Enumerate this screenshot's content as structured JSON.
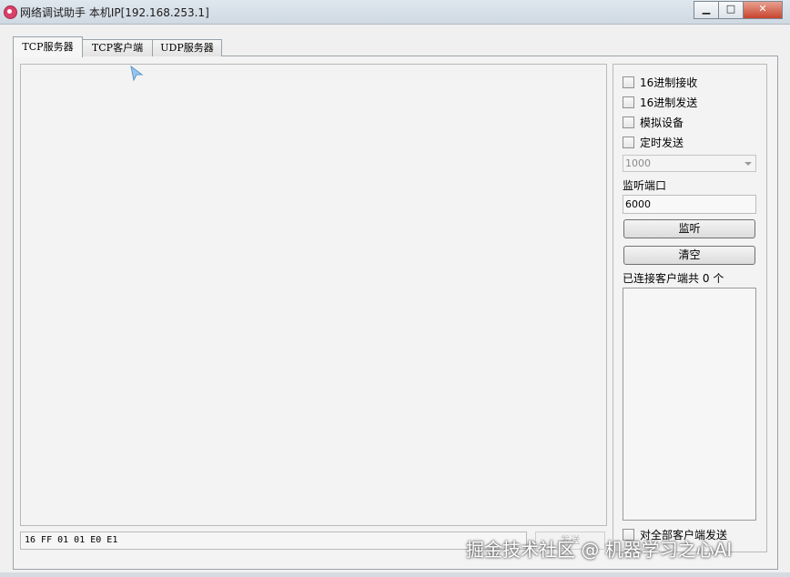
{
  "window": {
    "title": "网络调试助手 本机IP[192.168.253.1]",
    "minimize": "▁",
    "maximize": "□",
    "close": "✕"
  },
  "tabs": [
    {
      "label": "TCP服务器",
      "active": true
    },
    {
      "label": "TCP客户端",
      "active": false
    },
    {
      "label": "UDP服务器",
      "active": false
    }
  ],
  "receive_area": {
    "content": ""
  },
  "send": {
    "value": "16 FF 01 01 E0 E1",
    "button_label": "发送"
  },
  "options": {
    "hex_receive": "16进制接收",
    "hex_send": "16进制发送",
    "simulate_device": "模拟设备",
    "timed_send": "定时发送",
    "interval_value": "1000"
  },
  "listen": {
    "port_label": "监听端口",
    "port_value": "6000",
    "listen_button": "监听",
    "clear_button": "清空"
  },
  "clients": {
    "prefix": "已连接客户端共",
    "count": "0",
    "suffix": "个"
  },
  "broadcast_label": "对全部客户端发送",
  "watermark": "掘金技术社区 @ 机器学习之心AI"
}
